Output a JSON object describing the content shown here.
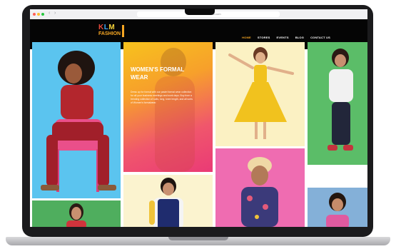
{
  "browser": {
    "address": "klmfashionmall.com"
  },
  "site": {
    "logo_main": "KLM",
    "logo_sub": "FASHION",
    "logo_letter_colors": [
      "#e94a3c",
      "#3fa9f5",
      "#f5d33a"
    ],
    "logo_bar_color": "#f5a623",
    "nav": [
      {
        "label": "HOME",
        "active": true
      },
      {
        "label": "STORES",
        "active": false
      },
      {
        "label": "EVENTS",
        "active": false
      },
      {
        "label": "BLOG",
        "active": false
      },
      {
        "label": "CONTACT US",
        "active": false
      }
    ]
  },
  "promo": {
    "title": "WOMEN'S FORMAL WEAR",
    "text": "Dress up for formal with our pastel formal wear collection for all your business meetings and work days. Buy from a trending collection of suits, long, knee length, and all sorts of Women's formalwear."
  },
  "colors": {
    "accent": "#f5a623",
    "header_bg": "#050505",
    "tile_blue": "#5bc4ef",
    "tile_cream": "#fbf1c3",
    "tile_green": "#5bbd68",
    "tile_pink": "#ef6cb1",
    "tile_steel": "#84b0d8"
  }
}
